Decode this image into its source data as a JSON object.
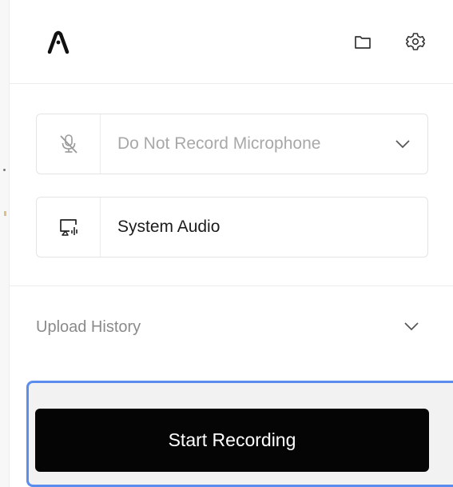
{
  "header": {
    "logo_icon": "logo-icon",
    "folder_icon": "folder-icon",
    "settings_icon": "gear-icon"
  },
  "audio": {
    "microphone": {
      "label": "Do Not Record Microphone",
      "icon": "mic-off-icon",
      "has_dropdown": true
    },
    "system": {
      "label": "System Audio",
      "icon": "screen-audio-icon"
    }
  },
  "upload_history": {
    "label": "Upload History",
    "expanded": false
  },
  "start_button": {
    "label": "Start Recording"
  },
  "colors": {
    "primary_button": "#050505",
    "focus_ring": "#5b8dee",
    "muted_text": "#a8a8a8"
  }
}
